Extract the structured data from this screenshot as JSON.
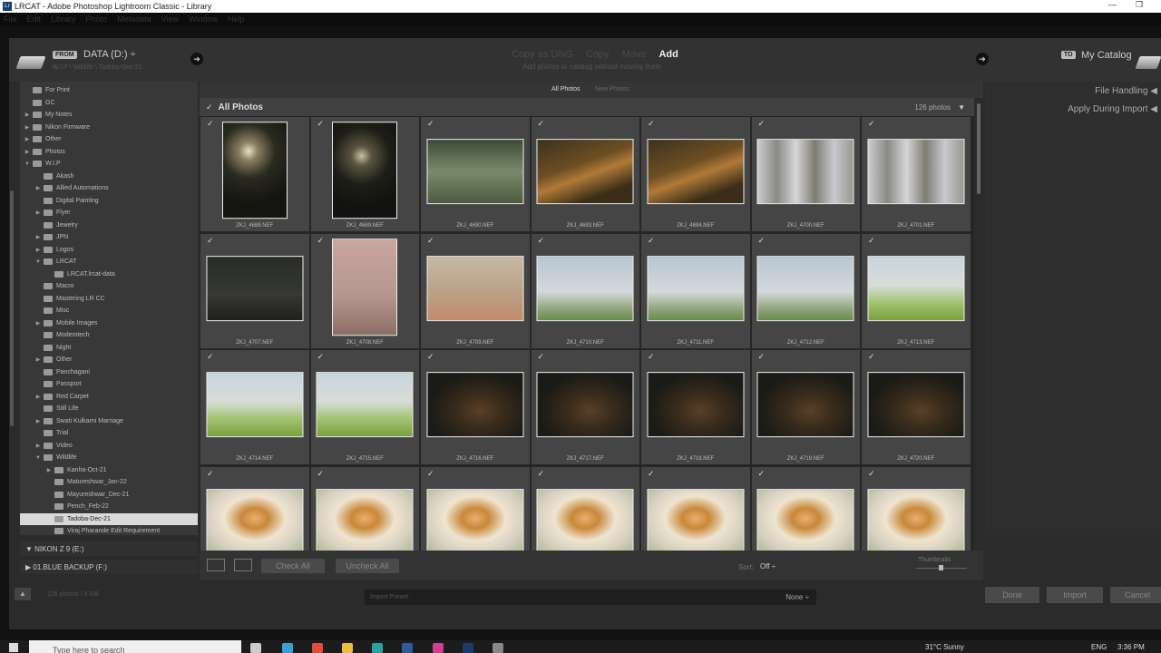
{
  "window": {
    "title": "LRCAT - Adobe Photoshop Lightroom Classic - Library",
    "app_badge": "Lr"
  },
  "menubar": [
    "File",
    "Edit",
    "Library",
    "Photo",
    "Metadata",
    "View",
    "Window",
    "Help"
  ],
  "header": {
    "from_badge": "FROM",
    "from_name": "DATA (D:) ÷",
    "from_path": "W.I.P \\ Wildlife \\ Tadoba-Dec-21",
    "modes": [
      "Copy as DNG",
      "Copy",
      "Move",
      "Add"
    ],
    "active_mode": "Add",
    "mode_description": "Add photos to catalog without moving them",
    "to_badge": "TO",
    "to_name": "My Catalog"
  },
  "source_tree": [
    {
      "label": "For Print",
      "indent": 1,
      "twisty": ""
    },
    {
      "label": "GC",
      "indent": 1,
      "twisty": ""
    },
    {
      "label": "My Notes",
      "indent": 1,
      "twisty": "▶"
    },
    {
      "label": "Nikon Firmware",
      "indent": 1,
      "twisty": "▶"
    },
    {
      "label": "Other",
      "indent": 1,
      "twisty": "▶"
    },
    {
      "label": "Photos",
      "indent": 1,
      "twisty": "▶"
    },
    {
      "label": "W.I.P",
      "indent": 1,
      "twisty": "▼"
    },
    {
      "label": "Akash",
      "indent": 2,
      "twisty": ""
    },
    {
      "label": "Allied Automations",
      "indent": 2,
      "twisty": "▶"
    },
    {
      "label": "Digital Painting",
      "indent": 2,
      "twisty": ""
    },
    {
      "label": "Flyer",
      "indent": 2,
      "twisty": "▶"
    },
    {
      "label": "Jewelry",
      "indent": 2,
      "twisty": ""
    },
    {
      "label": "JPN",
      "indent": 2,
      "twisty": "▶"
    },
    {
      "label": "Logos",
      "indent": 2,
      "twisty": "▶"
    },
    {
      "label": "LRCAT",
      "indent": 2,
      "twisty": "▼"
    },
    {
      "label": "LRCAT.lrcat-data",
      "indent": 3,
      "twisty": ""
    },
    {
      "label": "Macro",
      "indent": 2,
      "twisty": ""
    },
    {
      "label": "Mastering LR CC",
      "indent": 2,
      "twisty": ""
    },
    {
      "label": "Misc",
      "indent": 2,
      "twisty": ""
    },
    {
      "label": "Mobile Images",
      "indent": 2,
      "twisty": "▶"
    },
    {
      "label": "Modemtech",
      "indent": 2,
      "twisty": ""
    },
    {
      "label": "Night",
      "indent": 2,
      "twisty": ""
    },
    {
      "label": "Other",
      "indent": 2,
      "twisty": "▶"
    },
    {
      "label": "Panchagani",
      "indent": 2,
      "twisty": ""
    },
    {
      "label": "Passport",
      "indent": 2,
      "twisty": ""
    },
    {
      "label": "Red Carpet",
      "indent": 2,
      "twisty": "▶"
    },
    {
      "label": "Still Life",
      "indent": 2,
      "twisty": ""
    },
    {
      "label": "Swati Kulkarni Marriage",
      "indent": 2,
      "twisty": "▶"
    },
    {
      "label": "Trial",
      "indent": 2,
      "twisty": ""
    },
    {
      "label": "Video",
      "indent": 2,
      "twisty": "▶"
    },
    {
      "label": "Wildlife",
      "indent": 2,
      "twisty": "▼"
    },
    {
      "label": "Kanha-Oct-21",
      "indent": 3,
      "twisty": "▶"
    },
    {
      "label": "Matureshwar_Jan-22",
      "indent": 3,
      "twisty": ""
    },
    {
      "label": "Mayureshwar_Dec-21",
      "indent": 3,
      "twisty": ""
    },
    {
      "label": "Pench_Feb-22",
      "indent": 3,
      "twisty": ""
    },
    {
      "label": "Tadoba-Dec-21",
      "indent": 3,
      "twisty": "",
      "selected": true
    },
    {
      "label": "Viraj Pharande Edit Requirement",
      "indent": 3,
      "twisty": ""
    }
  ],
  "volumes": [
    {
      "label": "▼  NIKON Z 9   (E:)"
    },
    {
      "label": "▶  01.BLUE BACKUP (F:)"
    }
  ],
  "view_tabs": {
    "all": "All Photos",
    "new": "New Photos"
  },
  "grid_header": {
    "check": "✓",
    "title": "All Photos",
    "count": "126 photos",
    "menu": "▼"
  },
  "photos": [
    {
      "name": "ZKJ_4688.NEF",
      "style": "p-forest",
      "orient": "portrait"
    },
    {
      "name": "ZKJ_4689.NEF",
      "style": "p-forest2",
      "orient": "portrait"
    },
    {
      "name": "ZKJ_4690.NEF",
      "style": "p-green",
      "orient": "landscape"
    },
    {
      "name": "ZKJ_4693.NEF",
      "style": "p-tiger1",
      "orient": "landscape"
    },
    {
      "name": "ZKJ_4694.NEF",
      "style": "p-tiger1",
      "orient": "landscape"
    },
    {
      "name": "ZKJ_4700.NEF",
      "style": "p-trees",
      "orient": "landscape"
    },
    {
      "name": "ZKJ_4701.NEF",
      "style": "p-trees",
      "orient": "landscape"
    },
    {
      "name": "ZKJ_4707.NEF",
      "style": "p-dark",
      "orient": "landscape"
    },
    {
      "name": "ZKJ_4708.NEF",
      "style": "p-pink",
      "orient": "portrait"
    },
    {
      "name": "ZKJ_4709.NEF",
      "style": "p-road",
      "orient": "landscape"
    },
    {
      "name": "ZKJ_4710.NEF",
      "style": "p-mist",
      "orient": "landscape"
    },
    {
      "name": "ZKJ_4711.NEF",
      "style": "p-mist",
      "orient": "landscape"
    },
    {
      "name": "ZKJ_4712.NEF",
      "style": "p-mist",
      "orient": "landscape"
    },
    {
      "name": "ZKJ_4713.NEF",
      "style": "p-mistg",
      "orient": "landscape"
    },
    {
      "name": "ZKJ_4714.NEF",
      "style": "p-mistg",
      "orient": "landscape"
    },
    {
      "name": "ZKJ_4715.NEF",
      "style": "p-mistg",
      "orient": "landscape"
    },
    {
      "name": "ZKJ_4716.NEF",
      "style": "p-tigdark",
      "orient": "landscape"
    },
    {
      "name": "ZKJ_4717.NEF",
      "style": "p-tigdark",
      "orient": "landscape"
    },
    {
      "name": "ZKJ_4718.NEF",
      "style": "p-tigdark",
      "orient": "landscape"
    },
    {
      "name": "ZKJ_4719.NEF",
      "style": "p-tigdark",
      "orient": "landscape"
    },
    {
      "name": "ZKJ_4720.NEF",
      "style": "p-tigdark",
      "orient": "landscape"
    },
    {
      "name": "",
      "style": "p-tigbright",
      "orient": "landscape"
    },
    {
      "name": "",
      "style": "p-tigbright",
      "orient": "landscape"
    },
    {
      "name": "",
      "style": "p-tigbright",
      "orient": "landscape"
    },
    {
      "name": "",
      "style": "p-tigbright",
      "orient": "landscape"
    },
    {
      "name": "",
      "style": "p-tigbright",
      "orient": "landscape"
    },
    {
      "name": "",
      "style": "p-tigbright",
      "orient": "landscape"
    },
    {
      "name": "",
      "style": "p-tigbright",
      "orient": "landscape"
    }
  ],
  "right_panel": {
    "file_handling": "File Handling",
    "apply_during_import": "Apply During Import"
  },
  "toolbar": {
    "check_all": "Check All",
    "uncheck_all": "Uncheck All",
    "sort_label": "Sort:",
    "sort_value": "Off ÷",
    "thumbnails_label": "Thumbnails"
  },
  "footer": {
    "status": "126 photos / 9 GB",
    "preset_label": "Import Preset :",
    "preset_value": "None ÷",
    "done": "Done",
    "import": "Import",
    "cancel": "Cancel"
  },
  "taskbar": {
    "search_placeholder": "Type here to search",
    "weather": "31°C  Sunny",
    "lang": "ENG",
    "time": "3:36 PM"
  }
}
